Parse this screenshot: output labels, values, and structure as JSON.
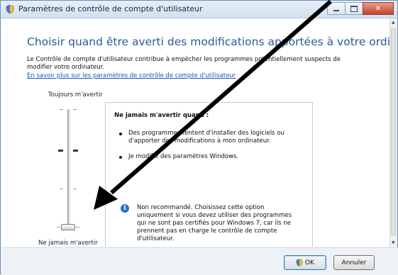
{
  "window": {
    "title": "Paramètres de contrôle de compte d'utilisateur"
  },
  "main": {
    "heading": "Choisir quand être averti des modifications apportées à votre ordinateur",
    "description": "Le Contrôle de compte d'utilisateur contribue à empêcher les programmes potentiellement suspects de modifier votre ordinateur.",
    "link": "En savoir plus sur les paramètres de contrôle de compte d'utilisateur"
  },
  "slider": {
    "top_label": "Toujours m'avertir",
    "bottom_label": "Ne jamais m'avertir",
    "selected_level": 1,
    "level_count": 4
  },
  "info": {
    "title": "Ne jamais m'avertir quand :",
    "items": [
      "Des programmes tentent d'installer des logiciels ou d'apporter des modifications à mon ordinateur.",
      "Je modifie des paramètres Windows."
    ],
    "note": "Non recommandé. Choisissez cette option uniquement si vous devez utiliser des programmes qui ne sont pas certifiés pour Windows 7, car ils ne prennent pas en charge le contrôle de compte d'utilisateur."
  },
  "buttons": {
    "ok": "OK",
    "cancel": "Annuler"
  },
  "colors": {
    "heading": "#2a5a9a",
    "link": "#1b56b0",
    "arrow": "#000000"
  }
}
